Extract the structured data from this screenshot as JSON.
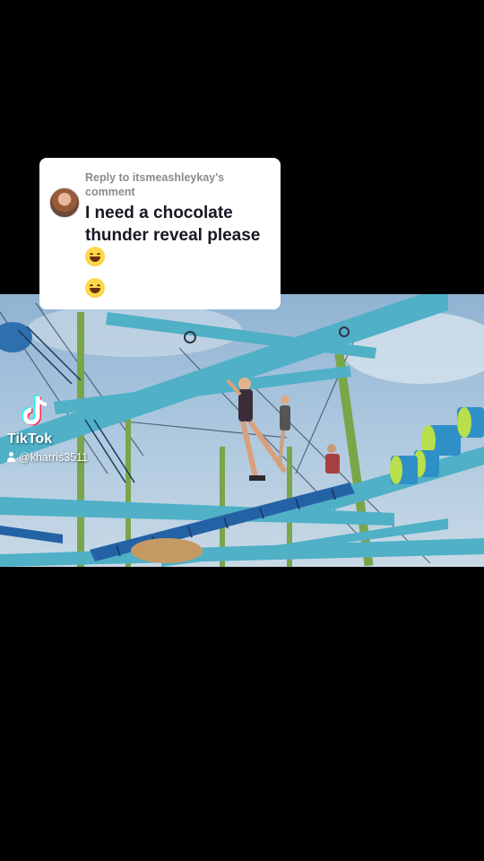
{
  "reply_card": {
    "reply_label": "Reply to itsmeashleykay's comment",
    "comment": "I need a chocolate thunder reveal please"
  },
  "watermark": {
    "brand": "TikTok",
    "handle": "@kharris3511"
  },
  "icons": [
    "avatar",
    "grinning-squinting-emoji",
    "tiktok-logo-icon",
    "user-icon"
  ],
  "colors": {
    "background": "#000000",
    "card": "#ffffff",
    "structure_beam": "#4fb0c6",
    "post_green": "#7aa64a"
  }
}
